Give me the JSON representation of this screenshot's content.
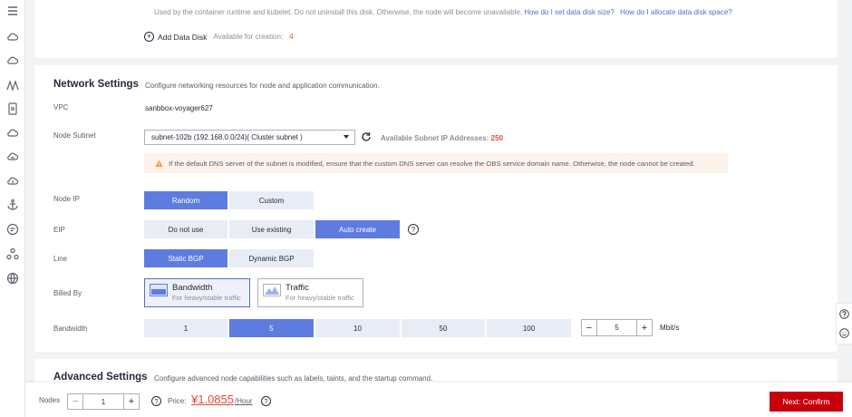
{
  "nav": {
    "icons": [
      "menu-icon",
      "cloud-icon",
      "cloud-icon",
      "chart-icon",
      "phone-icon",
      "cloud-icon",
      "cloud-icon",
      "cloud-icon",
      "anchor-icon",
      "circle-icon",
      "network-icon",
      "globe-icon"
    ]
  },
  "disk": {
    "tip": "Used by the container runtime and kubelet. Do not uninstall this disk. Otherwise, the node will become unavailable.",
    "link1": "How do I set data disk size?",
    "link2": "How do I allocate data disk space?",
    "add_label": "Add Data Disk",
    "avail_label": "Available for creation:",
    "avail_count": "4"
  },
  "network": {
    "title": "Network Settings",
    "description": "Configure networking resources for node and application communication.",
    "vpc_label": "VPC",
    "vpc_value": "sanbbox-voyager627",
    "subnet_label": "Node Subnet",
    "subnet_value": "subnet-102b (192.168.0.0/24)( Cluster subnet )",
    "avail_ip_label": "Available Subnet IP Addresses:",
    "avail_ip_count": "250",
    "warning": "If the default DNS server of the subnet is modified, ensure that the custom DNS server can resolve the OBS service domain name. Otherwise, the node cannot be created.",
    "node_ip_label": "Node IP",
    "node_ip_options": [
      "Random",
      "Custom"
    ],
    "eip_label": "EIP",
    "eip_options": [
      "Do not use",
      "Use existing",
      "Auto create"
    ],
    "line_label": "Line",
    "line_options": [
      "Static BGP",
      "Dynamic BGP"
    ],
    "billed_label": "Billed By",
    "billing": [
      {
        "title": "Bandwidth",
        "sub": "For heavy/stable traffic"
      },
      {
        "title": "Traffic",
        "sub": "For heavy/stable traffic"
      }
    ],
    "bandwidth_label": "Bandwidth",
    "bandwidth_options": [
      "1",
      "5",
      "10",
      "50",
      "100"
    ],
    "bandwidth_value": "5",
    "bandwidth_unit": "Mbit/s"
  },
  "advanced": {
    "title": "Advanced Settings",
    "description": "Configure advanced node capabilities such as labels, taints, and the startup command."
  },
  "footer": {
    "nodes_label": "Nodes",
    "nodes_value": "1",
    "price_label": "Price:",
    "price_value": "¥1.0855",
    "price_unit": "/Hour",
    "next_label": "Next: Confirm"
  },
  "colors": {
    "accent": "#5e7ce0",
    "primary_button": "#c7000b",
    "price": "#e64b36"
  }
}
